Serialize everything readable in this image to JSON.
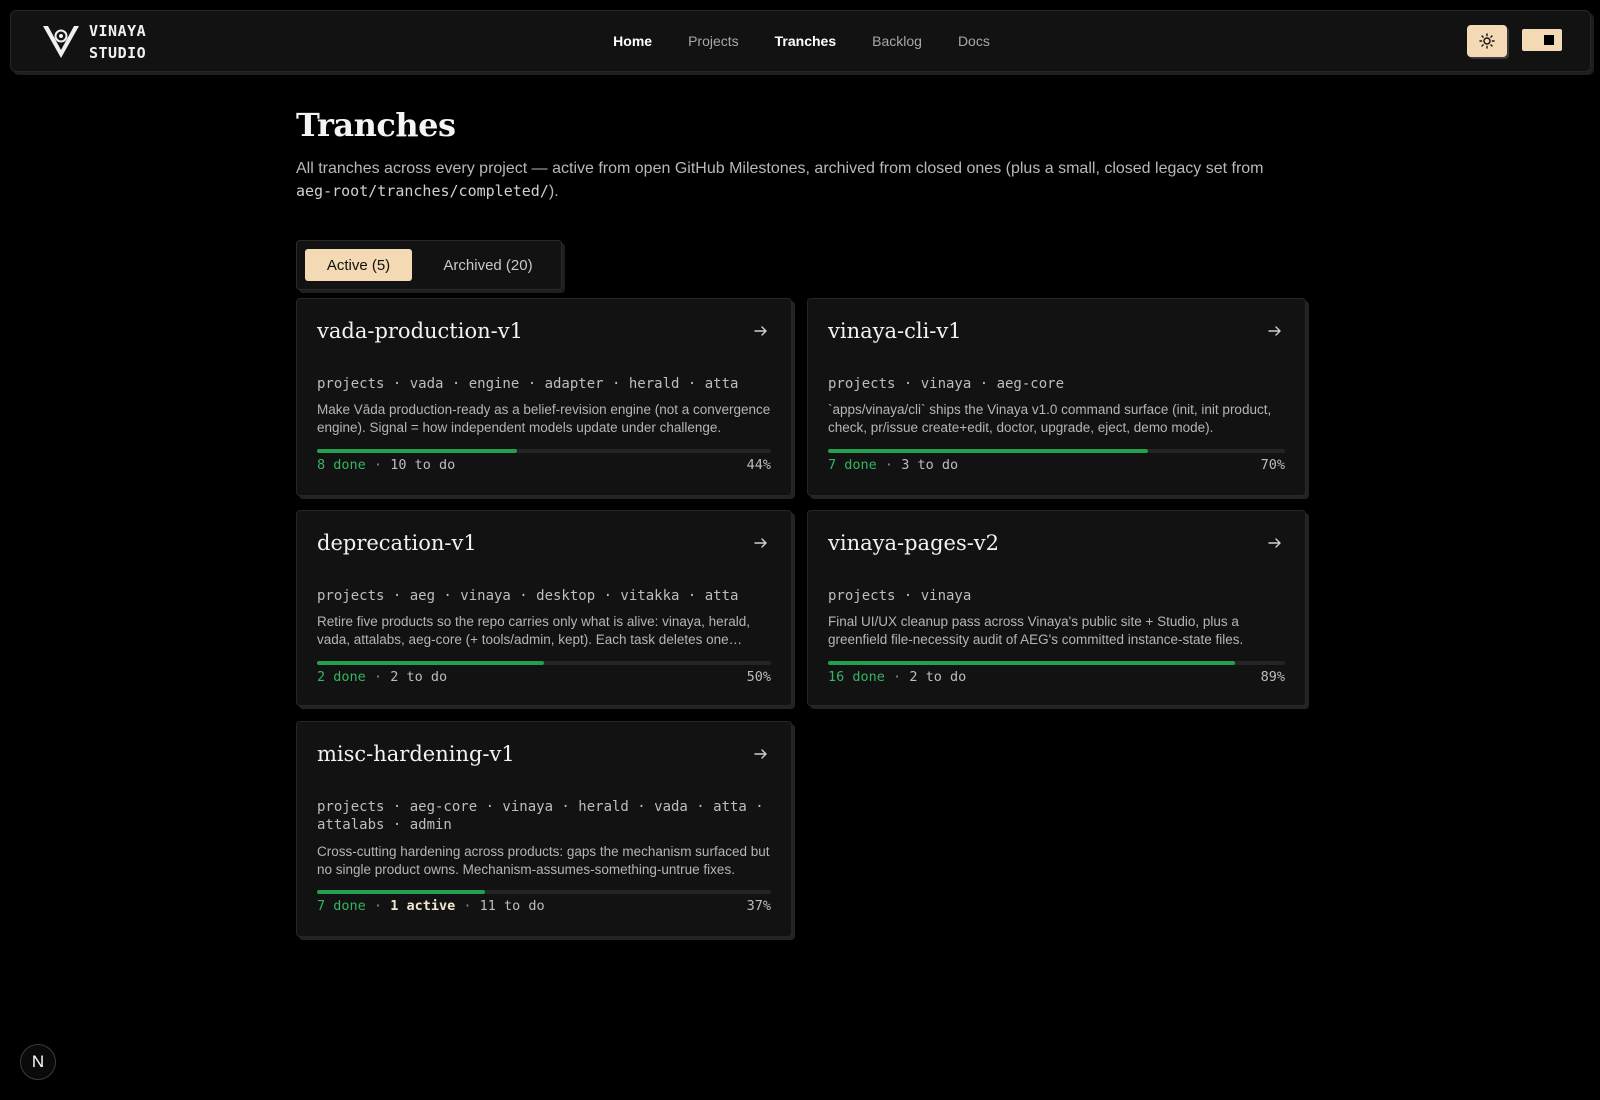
{
  "app": {
    "logo_line1": "VINAYA",
    "logo_line2": "STUDIO",
    "brand_color": "#f3d9b4"
  },
  "nav": {
    "items": [
      {
        "label": "Home",
        "active": true
      },
      {
        "label": "Projects",
        "active": false
      },
      {
        "label": "Tranches",
        "active": true
      },
      {
        "label": "Backlog",
        "active": false
      },
      {
        "label": "Docs",
        "active": false
      }
    ]
  },
  "header": {
    "theme_icon": "sun-icon",
    "toggle_icon": "toggle-icon"
  },
  "page": {
    "title": "Tranches",
    "description_prefix": "All tranches across every project — active from open GitHub Milestones, archived from closed ones (plus a small, closed legacy set from ",
    "description_code": "aeg-root/tranches/completed/",
    "description_suffix": ")."
  },
  "tabs": {
    "active_label": "Active (5)",
    "archived_label": "Archived (20)"
  },
  "cards": [
    {
      "title": "vada-production-v1",
      "projects": "projects · vada · engine · adapter · herald · atta",
      "description": "Make Vāda production-ready as a belief-revision engine (not a convergence engine). Signal = how independent models update under challenge.",
      "done": "8 done",
      "active": "",
      "todo": "10 to do",
      "progress": 44,
      "percent": "44%"
    },
    {
      "title": "vinaya-cli-v1",
      "projects": "projects · vinaya · aeg-core",
      "description": "`apps/vinaya/cli` ships the Vinaya v1.0 command surface (init, init product, check, pr/issue create+edit, doctor, upgrade, eject, demo mode).",
      "done": "7 done",
      "active": "",
      "todo": "3 to do",
      "progress": 70,
      "percent": "70%"
    },
    {
      "title": "deprecation-v1",
      "projects": "projects · aeg · vinaya · desktop · vitakka · atta",
      "description": "Retire five products so the repo carries only what is alive: vinaya, herald, vada, attalabs, aeg-core (+ tools/admin, kept). Each task deletes one product.",
      "done": "2 done",
      "active": "",
      "todo": "2 to do",
      "progress": 50,
      "percent": "50%"
    },
    {
      "title": "vinaya-pages-v2",
      "projects": "projects · vinaya",
      "description": "Final UI/UX cleanup pass across Vinaya's public site + Studio, plus a greenfield file-necessity audit of AEG's committed instance-state files.",
      "done": "16 done",
      "active": "",
      "todo": "2 to do",
      "progress": 89,
      "percent": "89%"
    },
    {
      "title": "misc-hardening-v1",
      "projects": "projects · aeg-core · vinaya · herald · vada · atta · attalabs · admin",
      "description": "Cross-cutting hardening across products: gaps the mechanism surfaced but no single product owns. Mechanism-assumes-something-untrue fixes.",
      "done": "7 done",
      "active": "1 active",
      "todo": "11 to do",
      "progress": 37,
      "percent": "37%"
    }
  ],
  "footer": {
    "badge": "N"
  }
}
